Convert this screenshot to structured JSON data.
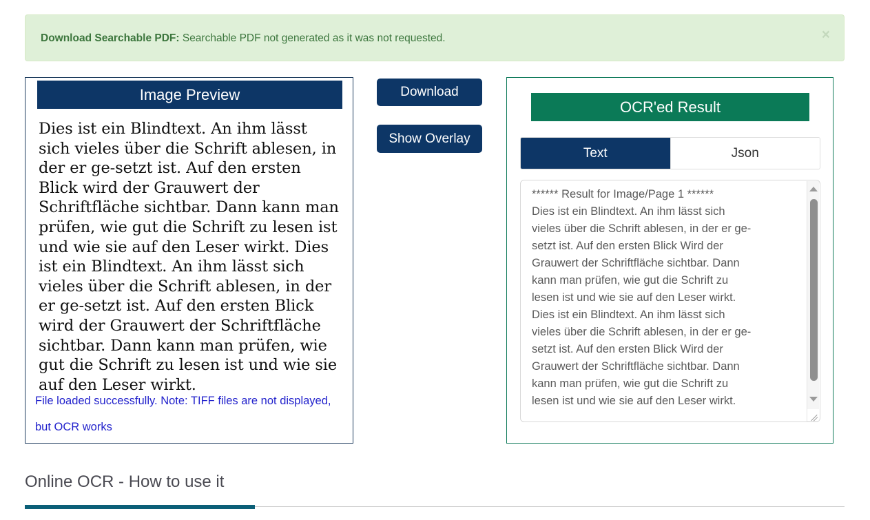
{
  "alert": {
    "label": "Download Searchable PDF:",
    "message": " Searchable PDF not generated as it was not requested.",
    "close_icon": "×",
    "bg_color": "#dff0d8",
    "text_color": "#3c763d"
  },
  "preview": {
    "header": "Image Preview",
    "header_color": "#0d3666",
    "body_text": "Dies ist ein Blindtext. An ihm lässt sich vieles über die Schrift ablesen, in der er ge-setzt ist. Auf den ersten Blick wird der Grauwert der Schriftfläche sichtbar. Dann kann man prüfen, wie gut die Schrift zu lesen ist und wie sie auf den Leser wirkt. Dies ist ein Blindtext. An ihm lässt sich vieles über die Schrift ablesen, in der er ge-setzt ist. Auf den ersten Blick wird der Grauwert der Schriftfläche sichtbar. Dann kann man prüfen, wie gut die Schrift zu lesen ist und wie sie auf den Leser wirkt.",
    "note": "File loaded successfully. Note: TIFF files are not displayed, but OCR works",
    "note_color": "#2222cc"
  },
  "actions": {
    "download_label": "Download",
    "overlay_label": "Show Overlay",
    "button_color": "#0d3666"
  },
  "result": {
    "header": "OCR'ed Result",
    "header_color": "#0b7a57",
    "tabs": [
      {
        "label": "Text",
        "active": true
      },
      {
        "label": "Json",
        "active": false
      }
    ],
    "text": "****** Result for Image/Page 1 ******\nDies ist ein Blindtext. An ihm lässt sich\nvieles über die Schrift ablesen, in der er ge-\nsetzt ist. Auf den ersten Blick Wird der\nGrauwert der Schriftfläche sichtbar. Dann\nkann man prüfen, wie gut die Schrift zu\nlesen ist und wie sie auf den Leser wirkt.\nDies ist ein Blindtext. An ihm lässt sich\nvieles über die Schrift ablesen, in der er ge-\nsetzt ist. Auf den ersten Blick Wird der\nGrauwert der Schriftfläche sichtbar. Dann\nkann man prüfen, wie gut die Schrift zu\nlesen ist und wie sie auf den Leser wirkt."
  },
  "howto": {
    "title": "Online OCR - How to use it",
    "accent_color": "#0b5f77"
  }
}
